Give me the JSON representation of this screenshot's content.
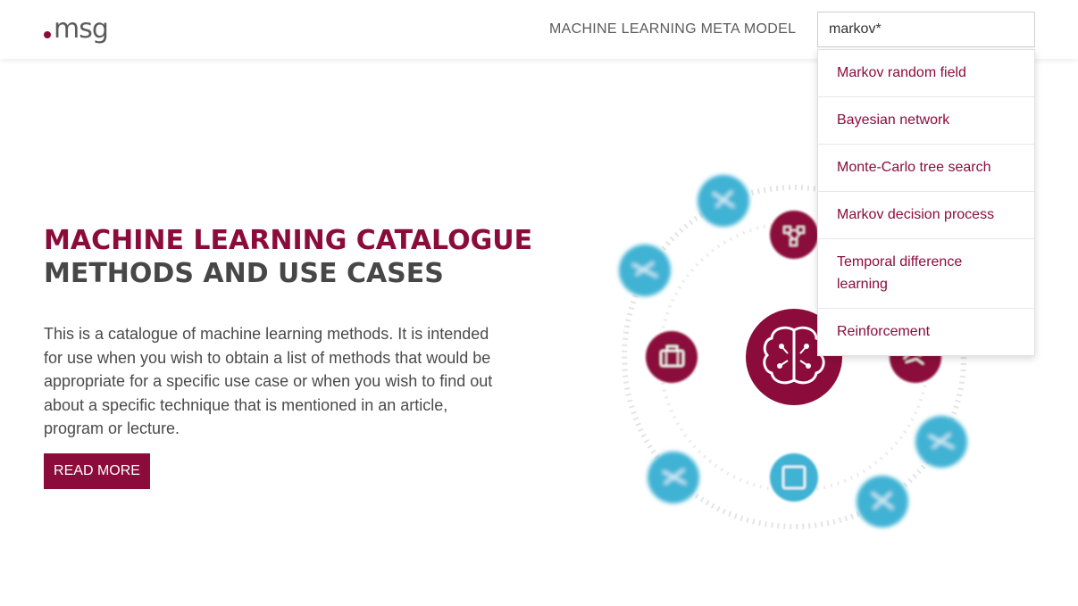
{
  "header": {
    "logo_text": "msg",
    "nav_title": "MACHINE LEARNING META MODEL"
  },
  "search": {
    "value": "markov*",
    "suggestions": [
      "Markov random field",
      "Bayesian network",
      "Monte-Carlo tree search",
      "Markov decision process",
      "Temporal difference learning",
      "Reinforcement"
    ]
  },
  "hero": {
    "title_line1": "MACHINE LEARNING CATALOGUE",
    "title_line2": "METHODS AND USE CASES",
    "description": "This is a catalogue of machine learning methods. It is intended for use when you wish to obtain a list of methods that would be appropriate for a specific use case or when you wish to find out about a specific technique that is mentioned in an article, program or lecture.",
    "button_label": "READ MORE"
  },
  "graphic": {
    "icons": [
      "brain-icon",
      "network-icon",
      "briefcase-icon",
      "handshake-icon",
      "square-icon"
    ]
  },
  "colors": {
    "brand": "#8b0c3b",
    "accent": "#3fb2d4",
    "text": "#4a4a4a"
  }
}
